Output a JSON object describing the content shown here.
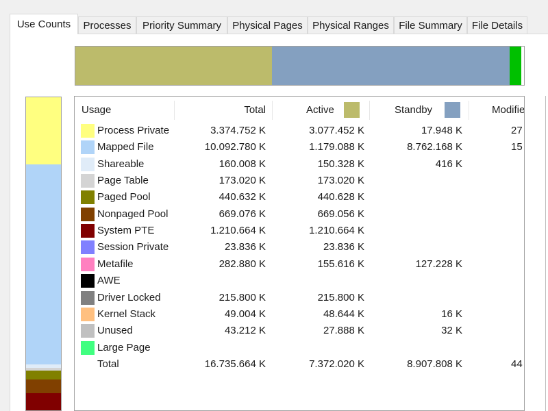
{
  "tabs": [
    {
      "label": "Use Counts",
      "active": true
    },
    {
      "label": "Processes"
    },
    {
      "label": "Priority Summary"
    },
    {
      "label": "Physical Pages"
    },
    {
      "label": "Physical Ranges"
    },
    {
      "label": "File Summary"
    },
    {
      "label": "File Details"
    }
  ],
  "colors": {
    "active_legend": "#bcbb6b",
    "standby_legend": "#84a0c0",
    "modified_topbar": "#00c000"
  },
  "table": {
    "headers": {
      "usage": "Usage",
      "total": "Total",
      "active": "Active",
      "standby": "Standby",
      "modified": "Modifie"
    },
    "rows": [
      {
        "name": "Process Private",
        "color": "#ffff80",
        "total": "3.374.752 K",
        "active": "3.077.452 K",
        "standby": "17.948 K",
        "modified": "27"
      },
      {
        "name": "Mapped File",
        "color": "#b0d4f8",
        "total": "10.092.780 K",
        "active": "1.179.088 K",
        "standby": "8.762.168 K",
        "modified": "15"
      },
      {
        "name": "Shareable",
        "color": "#e0ecf8",
        "total": "160.008 K",
        "active": "150.328 K",
        "standby": "416 K",
        "modified": ""
      },
      {
        "name": "Page Table",
        "color": "#d4d4d4",
        "total": "173.020 K",
        "active": "173.020 K",
        "standby": "",
        "modified": ""
      },
      {
        "name": "Paged Pool",
        "color": "#808000",
        "total": "440.632 K",
        "active": "440.628 K",
        "standby": "",
        "modified": ""
      },
      {
        "name": "Nonpaged Pool",
        "color": "#804000",
        "total": "669.076 K",
        "active": "669.056 K",
        "standby": "",
        "modified": ""
      },
      {
        "name": "System PTE",
        "color": "#800000",
        "total": "1.210.664 K",
        "active": "1.210.664 K",
        "standby": "",
        "modified": ""
      },
      {
        "name": "Session Private",
        "color": "#8080ff",
        "total": "23.836 K",
        "active": "23.836 K",
        "standby": "",
        "modified": ""
      },
      {
        "name": "Metafile",
        "color": "#ff80c0",
        "total": "282.880 K",
        "active": "155.616 K",
        "standby": "127.228 K",
        "modified": ""
      },
      {
        "name": "AWE",
        "color": "#000000",
        "total": "",
        "active": "",
        "standby": "",
        "modified": ""
      },
      {
        "name": "Driver Locked",
        "color": "#808080",
        "total": "215.800 K",
        "active": "215.800 K",
        "standby": "",
        "modified": ""
      },
      {
        "name": "Kernel Stack",
        "color": "#ffc080",
        "total": "49.004 K",
        "active": "48.644 K",
        "standby": "16 K",
        "modified": ""
      },
      {
        "name": "Unused",
        "color": "#c0c0c0",
        "total": "43.212 K",
        "active": "27.888 K",
        "standby": "32 K",
        "modified": ""
      },
      {
        "name": "Large Page",
        "color": "#40ff80",
        "total": "",
        "active": "",
        "standby": "",
        "modified": ""
      },
      {
        "name": "Total",
        "color": "",
        "total": "16.735.664 K",
        "active": "7.372.020 K",
        "standby": "8.907.808 K",
        "modified": "44"
      }
    ]
  }
}
